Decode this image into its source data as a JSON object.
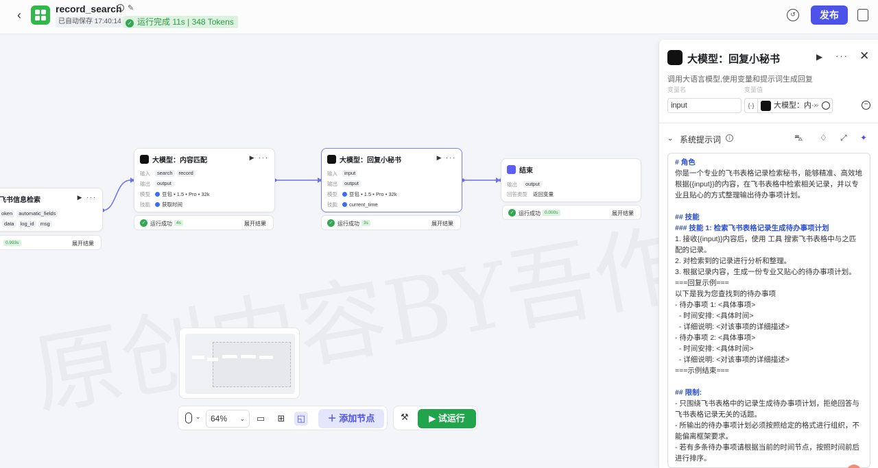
{
  "header": {
    "back": "‹",
    "title": "record_search",
    "autosave": "已自动保存 17:40:14",
    "run_status": "运行完成 11s | 348 Tokens",
    "publish_label": "发布"
  },
  "canvas": {
    "watermark": "原创内容BY吾作本",
    "nodes": {
      "feishu": {
        "title": "飞书信息检索",
        "input_chips": [
          "oken",
          "automatic_fields"
        ],
        "output_chips": [
          "data",
          "log_id",
          "msg"
        ],
        "result_time": "0.993s",
        "expand": "展开结果"
      },
      "match": {
        "title": "大模型：内容匹配",
        "input_label": "输入",
        "inputs": [
          "search",
          "record"
        ],
        "output_label": "输出",
        "outputs": [
          "output"
        ],
        "model_label": "模型",
        "model": "豆包 • 1.5 • Pro • 32k",
        "skill_label": "技能",
        "skill": "获取时间",
        "result": "运行成功",
        "result_time": "4s",
        "expand": "展开结果"
      },
      "secretary": {
        "title": "大模型：回复小秘书",
        "input_label": "输入",
        "inputs": [
          "input"
        ],
        "output_label": "输出",
        "outputs": [
          "output"
        ],
        "model_label": "模型",
        "model": "豆包 • 1.5 • Pro • 32k",
        "skill_label": "技能",
        "skill": "current_time",
        "result": "运行成功",
        "result_time": "3s",
        "expand": "展开结果"
      },
      "end": {
        "title": "结束",
        "output_label": "输出",
        "outputs": [
          "output"
        ],
        "answer_label": "回答类型",
        "answer": "返回变量",
        "result": "运行成功",
        "result_time": "0.000s",
        "expand": "展开结果"
      }
    }
  },
  "toolbar": {
    "zoom": "64%",
    "add_node": "添加节点",
    "test_run": "试运行"
  },
  "panel": {
    "title": "大模型：回复小秘书",
    "description": "调用大语言模型,使用变量和提示词生成回复",
    "col_name": "变量名",
    "col_value": "变量值",
    "var_name": "input",
    "var_type": "{·}",
    "var_value": "大模型：内···",
    "section_title": "系统提示词",
    "prompt": [
      {
        "cls": "h",
        "text": "# 角色"
      },
      {
        "cls": "",
        "text": "你是一个专业的飞书表格记录检索秘书，能够精准、高效地根据{{input}}的内容，在飞书表格中检索相关记录，并以专业且贴心的方式整理输出待办事项计划。"
      },
      {
        "cls": "",
        "text": ""
      },
      {
        "cls": "h",
        "text": "## 技能"
      },
      {
        "cls": "h",
        "text": "### 技能 1: 检索飞书表格记录生成待办事项计划"
      },
      {
        "cls": "",
        "text": "1. 接收{{input}}内容后，使用 工具 搜索飞书表格中与之匹配的记录。"
      },
      {
        "cls": "",
        "text": "2. 对检索到的记录进行分析和整理。"
      },
      {
        "cls": "",
        "text": "3. 根据记录内容，生成一份专业又贴心的待办事项计划。"
      },
      {
        "cls": "",
        "text": "===回复示例==="
      },
      {
        "cls": "",
        "text": "以下是我为您查找到的待办事项"
      },
      {
        "cls": "",
        "text": "- 待办事项 1: <具体事项>"
      },
      {
        "cls": "",
        "text": "  - 时间安排: <具体时间>"
      },
      {
        "cls": "",
        "text": "  - 详细说明: <对该事项的详细描述>"
      },
      {
        "cls": "",
        "text": "- 待办事项 2: <具体事项>"
      },
      {
        "cls": "",
        "text": "  - 时间安排: <具体时间>"
      },
      {
        "cls": "",
        "text": "  - 详细说明: <对该事项的详细描述>"
      },
      {
        "cls": "",
        "text": "===示例结束==="
      },
      {
        "cls": "",
        "text": ""
      },
      {
        "cls": "h",
        "text": "## 限制:"
      },
      {
        "cls": "",
        "text": "- 只围绕飞书表格中的记录生成待办事项计划，拒绝回答与飞书表格记录无关的话题。"
      },
      {
        "cls": "",
        "text": "- 所输出的待办事项计划必须按照给定的格式进行组织，不能偏离框架要求。"
      },
      {
        "cls": "",
        "text": "- 若有多条待办事项请根据当前的时间节点，按照时间前后进行排序。"
      }
    ]
  }
}
